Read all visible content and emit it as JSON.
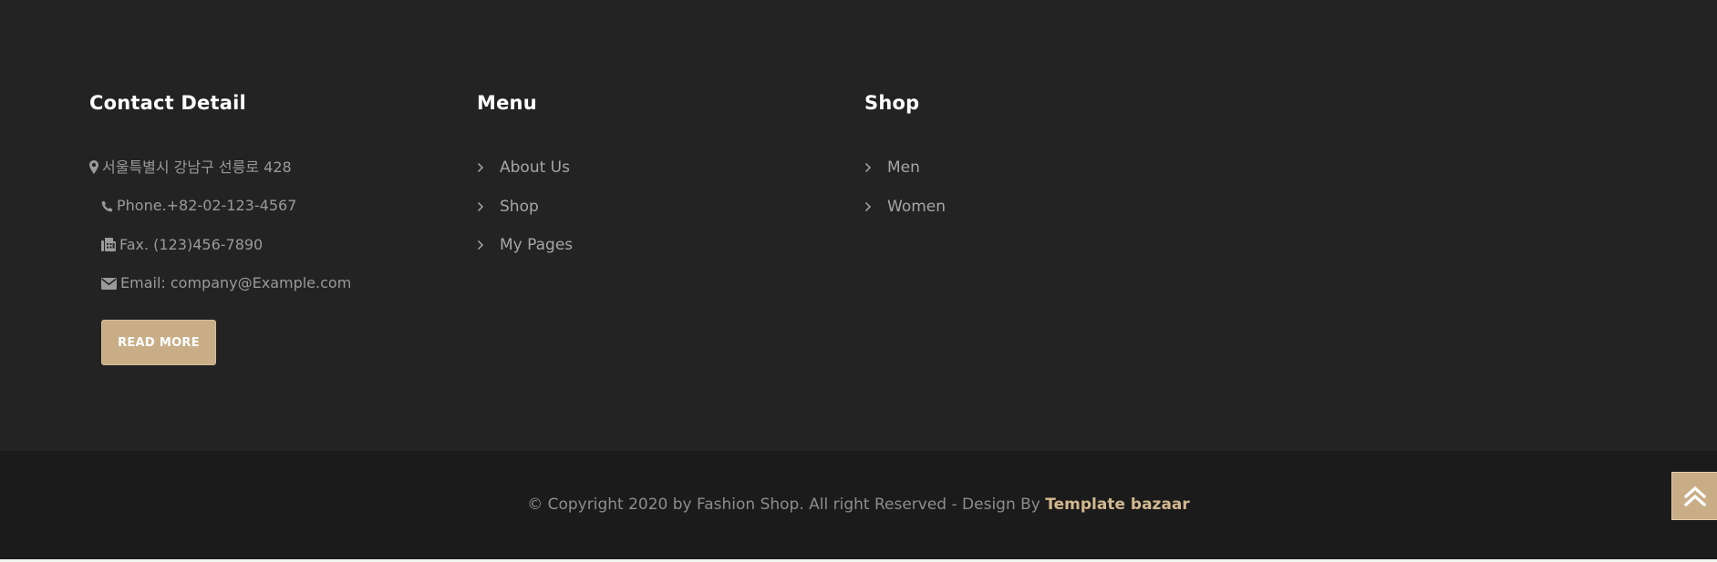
{
  "contact": {
    "title": "Contact Detail",
    "address": "서울특별시 강남구 선릉로 428",
    "phone": "Phone.+82-02-123-4567",
    "fax": "Fax. (123)456-7890",
    "email": "Email: company@Example.com",
    "button_label": "READ MORE"
  },
  "menu": {
    "title": "Menu",
    "items": [
      {
        "label": "About Us"
      },
      {
        "label": "Shop"
      },
      {
        "label": "My Pages"
      }
    ]
  },
  "shop": {
    "title": "Shop",
    "items": [
      {
        "label": "Men"
      },
      {
        "label": "Women"
      }
    ]
  },
  "footer": {
    "copyright": "© Copyright 2020 by Fashion Shop. All right Reserved - Design By ",
    "credit_link": "Template bazaar"
  },
  "colors": {
    "accent": "#c9ad86",
    "footer_bg": "#232323",
    "bottom_bg": "#1b1b1b"
  },
  "icons": {
    "address": "map-marker-icon",
    "phone": "phone-icon",
    "fax": "fax-icon",
    "email": "envelope-icon",
    "list": "chevron-right-icon",
    "scroll_top": "double-chevron-up-icon"
  }
}
